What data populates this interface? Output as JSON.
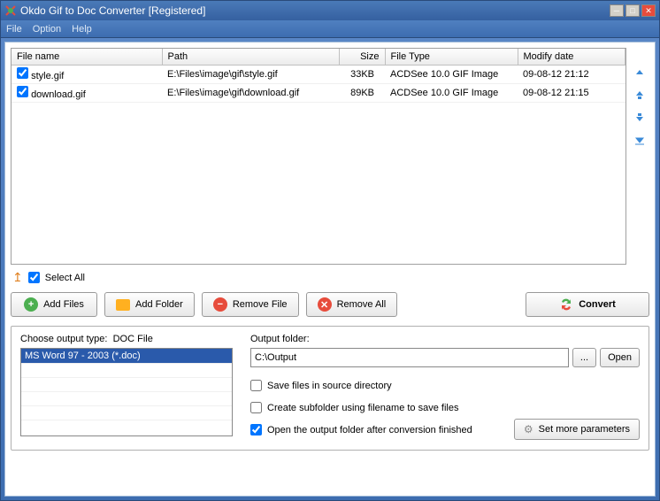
{
  "window": {
    "title": "Okdo Gif to Doc Converter [Registered]"
  },
  "menu": {
    "file": "File",
    "option": "Option",
    "help": "Help"
  },
  "table": {
    "columns": {
      "name": "File name",
      "path": "Path",
      "size": "Size",
      "type": "File Type",
      "modify": "Modify date"
    },
    "rows": [
      {
        "checked": true,
        "name": "style.gif",
        "path": "E:\\Files\\image\\gif\\style.gif",
        "size": "33KB",
        "type": "ACDSee 10.0 GIF Image",
        "modify": "09-08-12 21:12"
      },
      {
        "checked": true,
        "name": "download.gif",
        "path": "E:\\Files\\image\\gif\\download.gif",
        "size": "89KB",
        "type": "ACDSee 10.0 GIF Image",
        "modify": "09-08-12 21:15"
      }
    ]
  },
  "selectAll": {
    "label": "Select All",
    "checked": true
  },
  "buttons": {
    "addFiles": "Add Files",
    "addFolder": "Add Folder",
    "removeFile": "Remove File",
    "removeAll": "Remove All",
    "convert": "Convert"
  },
  "outputType": {
    "label": "Choose output type:",
    "current": "DOC File",
    "options": [
      "MS Word 97 - 2003 (*.doc)"
    ]
  },
  "outputFolder": {
    "label": "Output folder:",
    "value": "C:\\Output",
    "browse": "...",
    "open": "Open"
  },
  "options": {
    "saveInSource": {
      "label": "Save files in source directory",
      "checked": false
    },
    "createSubfolder": {
      "label": "Create subfolder using filename to save files",
      "checked": false
    },
    "openAfter": {
      "label": "Open the output folder after conversion finished",
      "checked": true
    }
  },
  "moreParams": "Set more parameters"
}
